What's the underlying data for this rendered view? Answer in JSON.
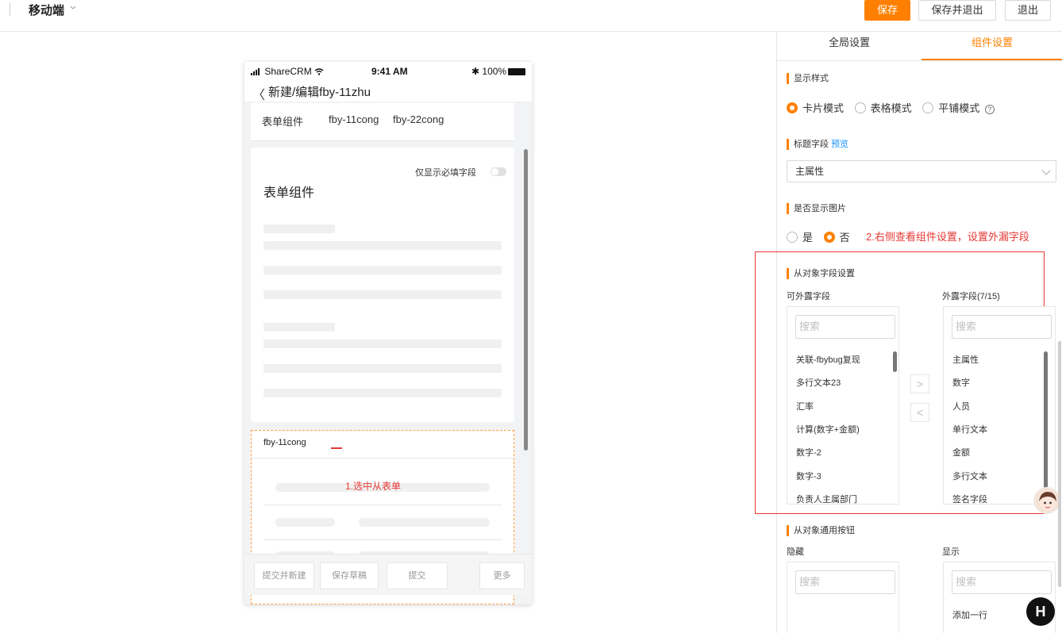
{
  "header": {
    "title": "移动端",
    "save_label": "保存",
    "save_exit_label": "保存并退出",
    "exit_label": "退出"
  },
  "phone": {
    "carrier": "ShareCRM",
    "time": "9:41 AM",
    "battery": "100%",
    "nav_title": "新建/编辑fby-11zhu",
    "tabs": [
      "表单组件",
      "fby-11cong",
      "fby-22cong"
    ],
    "required_only_label": "仅显示必填字段",
    "form_title": "表单组件",
    "subform_title": "fby-11cong",
    "annotation_1": "1.选中从表单",
    "footer": {
      "submit_new": "提交并新建",
      "save_draft": "保存草稿",
      "submit": "提交",
      "more": "更多"
    }
  },
  "panel": {
    "tabs": [
      "全局设置",
      "组件设置"
    ],
    "active_tab": "组件设置",
    "display_style": {
      "label": "显示样式",
      "options": [
        "卡片模式",
        "表格模式",
        "平铺模式"
      ],
      "selected": "卡片模式",
      "help_icon": "question-circle-icon"
    },
    "title_field": {
      "label": "标题字段",
      "preview_link": "预览",
      "value": "主属性"
    },
    "show_image": {
      "label": "是否显示图片",
      "options": [
        "是",
        "否"
      ],
      "selected": "否"
    },
    "annotation_2": "2.右侧查看组件设置，设置外漏字段",
    "field_settings": {
      "label": "从对象字段设置",
      "available_label": "可外露字段",
      "exposed_label": "外露字段(7/15)",
      "search_placeholder": "搜索",
      "available": [
        "关联-fbybug复现",
        "多行文本23",
        "汇率",
        "计算(数字+金额)",
        "数字-2",
        "数字-3",
        "负责人主属部门"
      ],
      "exposed": [
        "主属性",
        "数字",
        "人员",
        "单行文本",
        "金额",
        "多行文本",
        "签名字段"
      ]
    },
    "buttons_settings": {
      "label": "从对象通用按钮",
      "hidden_label": "隐藏",
      "shown_label": "显示",
      "search_placeholder": "搜索",
      "shown": [
        "添加一行"
      ]
    }
  },
  "colors": {
    "accent": "#ff8000",
    "annotation": "#e53935",
    "link": "#1890ff"
  }
}
